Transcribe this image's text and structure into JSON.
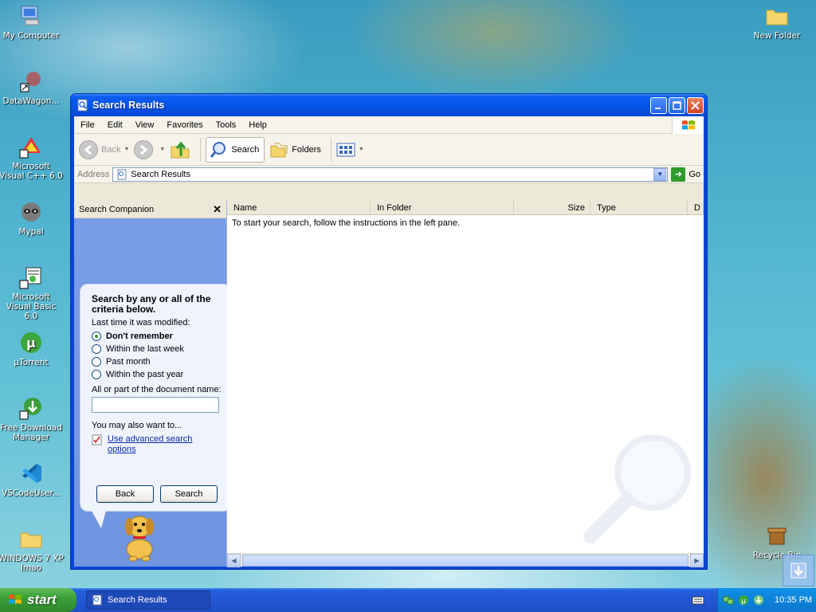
{
  "desktop": {
    "icons": [
      {
        "label": "My Computer",
        "icon": "computer-icon"
      },
      {
        "label": "DataWagon...",
        "icon": "shortcut-icon"
      },
      {
        "label": "Microsoft Visual C++ 6.0",
        "icon": "visual-cpp-icon"
      },
      {
        "label": "Mypal",
        "icon": "raccoon-icon"
      },
      {
        "label": "Microsoft Visual Basic 6.0",
        "icon": "visual-basic-icon"
      },
      {
        "label": "µTorrent",
        "icon": "utorrent-icon"
      },
      {
        "label": "Free Download Manager",
        "icon": "download-manager-icon"
      },
      {
        "label": "VSCodeUser...",
        "icon": "vscode-icon"
      },
      {
        "label": "WINDOWS 7 XP Imao",
        "icon": "folder-icon"
      },
      {
        "label": "New Folder",
        "icon": "folder-icon"
      },
      {
        "label": "Recycle Bin",
        "icon": "recycle-bin-icon"
      }
    ]
  },
  "window": {
    "title": "Search Results",
    "menu": [
      "File",
      "Edit",
      "View",
      "Favorites",
      "Tools",
      "Help"
    ],
    "toolbar": {
      "back": "Back",
      "search": "Search",
      "folders": "Folders"
    },
    "address": {
      "label": "Address",
      "value": "Search Results",
      "go": "Go"
    },
    "companion": {
      "title": "Search Companion",
      "close": "✕",
      "heading": "Search by any or all of the criteria below.",
      "modified_label": "Last time it was modified:",
      "options": [
        {
          "label": "Don't remember",
          "selected": true
        },
        {
          "label": "Within the last week",
          "selected": false
        },
        {
          "label": "Past month",
          "selected": false
        },
        {
          "label": "Within the past year",
          "selected": false
        }
      ],
      "docname_label": "All or part of the document name:",
      "docname_value": "",
      "also_label": "You may also want to...",
      "advanced_link": "Use advanced search options",
      "back_button": "Back",
      "search_button": "Search"
    },
    "results": {
      "columns": [
        "Name",
        "In Folder",
        "Size",
        "Type",
        "D"
      ],
      "message": "To start your search, follow the instructions in the left pane."
    }
  },
  "taskbar": {
    "start": "start",
    "task": "Search Results",
    "clock": "10:35 PM"
  }
}
